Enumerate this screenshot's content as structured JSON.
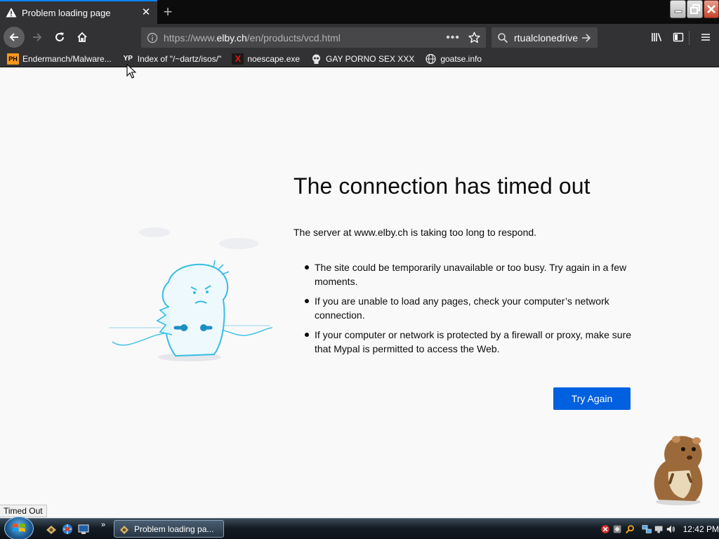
{
  "browser": {
    "tab": {
      "title": "Problem loading page",
      "icon": "warning-icon"
    },
    "newtab_icon": "plus-icon",
    "window_controls": [
      "minimize-icon",
      "restore-icon",
      "close-icon"
    ],
    "url": {
      "prefix": "https://www.",
      "host": "elby.ch",
      "path": "/en/products/vcd.html",
      "page_actions": "•••"
    },
    "search": {
      "query": "rtualclonedrive"
    },
    "accent_color": "#0a84ff"
  },
  "bookmarks": [
    {
      "label": "Endermanch/Malware...",
      "icon": "PH"
    },
    {
      "label": "Index of \"/~dartz/isos/\"",
      "icon": "YP"
    },
    {
      "label": "noescape.exe",
      "icon": "X"
    },
    {
      "label": "GAY PORNO SEX XXX",
      "icon": "skull-icon"
    },
    {
      "label": "goatse.info",
      "icon": "globe-icon"
    }
  ],
  "error": {
    "title": "The connection has timed out",
    "description": "The server at www.elby.ch is taking too long to respond.",
    "bullets": [
      "The site could be temporarily unavailable or too busy. Try again in a few moments.",
      "If you are unable to load any pages, check your computer’s network connection.",
      "If your computer or network is protected by a firewall or proxy, make sure that Mypal is permitted to access the Web."
    ],
    "button": "Try Again",
    "button_color": "#0060df"
  },
  "status": {
    "text": "Timed Out"
  },
  "taskbar": {
    "task_title": "Problem loading pa...",
    "chevron": "»",
    "clock": "12:42 PM"
  }
}
